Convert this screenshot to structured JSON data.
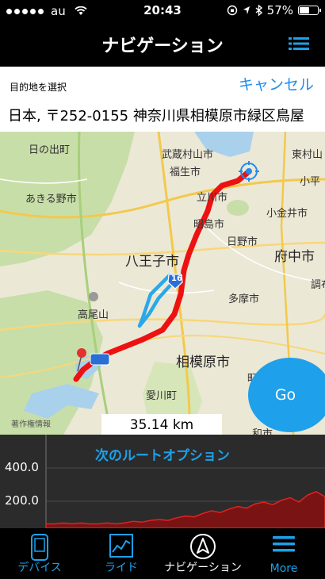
{
  "status_bar": {
    "carrier": "au",
    "time": "20:43",
    "battery": "57%",
    "battery_level": 0.57
  },
  "header": {
    "title": "ナビゲーション",
    "menu_icon": "list-icon"
  },
  "destination": {
    "label": "目的地を選択",
    "cancel_label": "キャンセル",
    "address": "日本, 〒252-0155 神奈川県相模原市緑区鳥屋"
  },
  "map": {
    "places": [
      "日の出町",
      "武蔵村山市",
      "東村山",
      "福生市",
      "小平",
      "あきる野市",
      "立川市",
      "小金井市",
      "昭島市",
      "日野市",
      "府中市",
      "八王子市",
      "調布",
      "高尾山",
      "多摩市",
      "相模原市",
      "愛川町",
      "町田",
      "和市"
    ],
    "route_number": "16",
    "attribution": "著作権情報",
    "distance": "35.14 km",
    "go_label": "Go",
    "colors": {
      "route": "#ee1111",
      "alt_route": "#2aa8e8",
      "land": "#ece8d6",
      "green": "#c8dea8",
      "water": "#a9d1ec"
    }
  },
  "elevation": {
    "title": "次のルートオプション",
    "y_ticks": [
      "400.0",
      "200.0"
    ],
    "profile": [
      0.05,
      0.05,
      0.06,
      0.05,
      0.06,
      0.05,
      0.05,
      0.06,
      0.05,
      0.06,
      0.08,
      0.07,
      0.09,
      0.1,
      0.09,
      0.12,
      0.14,
      0.13,
      0.17,
      0.2,
      0.18,
      0.22,
      0.25,
      0.23,
      0.28,
      0.3,
      0.27,
      0.32,
      0.35,
      0.3,
      0.38,
      0.42,
      0.36
    ]
  },
  "tabs": [
    {
      "label": "デバイス",
      "icon": "device-icon",
      "color": "#1ea0ea"
    },
    {
      "label": "ライド",
      "icon": "ride-chart-icon",
      "color": "#1ea0ea"
    },
    {
      "label": "ナビゲーション",
      "icon": "compass-icon",
      "color": "#ffffff"
    },
    {
      "label": "More",
      "icon": "more-icon",
      "color": "#1ea0ea"
    }
  ]
}
